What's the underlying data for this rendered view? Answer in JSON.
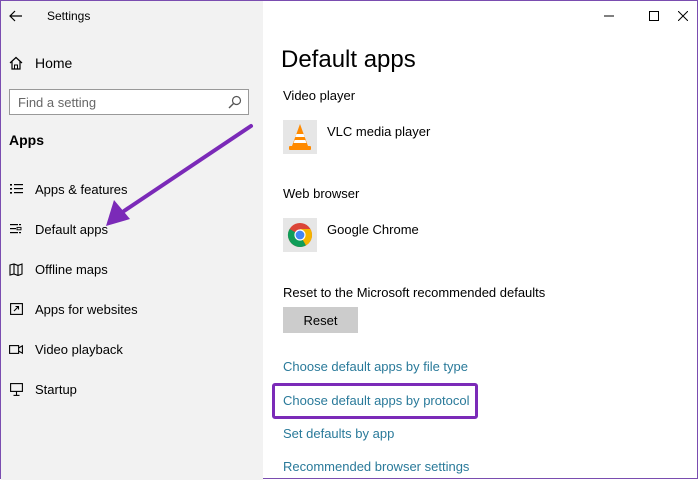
{
  "window": {
    "title": "Settings",
    "controls": {
      "minimize": "–",
      "maximize": "☐",
      "close": "✕"
    }
  },
  "sidebar": {
    "home_label": "Home",
    "search_placeholder": "Find a setting",
    "section": "Apps",
    "items": [
      {
        "label": "Apps & features",
        "icon": "list-icon"
      },
      {
        "label": "Default apps",
        "icon": "default-apps-icon"
      },
      {
        "label": "Offline maps",
        "icon": "map-icon"
      },
      {
        "label": "Apps for websites",
        "icon": "open-link-icon"
      },
      {
        "label": "Video playback",
        "icon": "video-icon"
      },
      {
        "label": "Startup",
        "icon": "startup-icon"
      }
    ]
  },
  "main": {
    "title": "Default apps",
    "video_player": {
      "label": "Video player",
      "app": "VLC media player"
    },
    "web_browser": {
      "label": "Web browser",
      "app": "Google Chrome"
    },
    "reset": {
      "label": "Reset to the Microsoft recommended defaults",
      "button": "Reset"
    },
    "links": [
      "Choose default apps by file type",
      "Choose default apps by protocol",
      "Set defaults by app",
      "Recommended browser settings"
    ]
  },
  "colors": {
    "link": "#2a7a9a",
    "annotation": "#7b2ab8",
    "sidebar_bg": "#f2f2f2",
    "button_bg": "#cccccc"
  }
}
